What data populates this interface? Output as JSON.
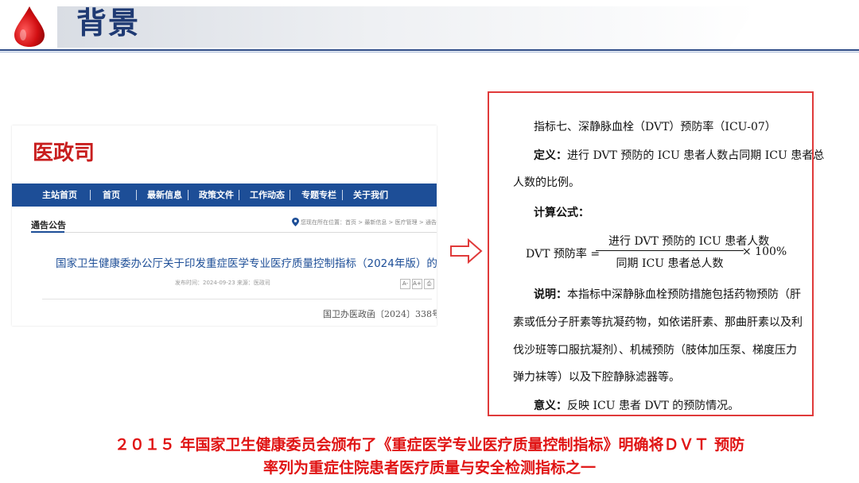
{
  "header": {
    "title": "背景"
  },
  "screenshot": {
    "site_name": "医政司",
    "nav": [
      "主站首页",
      "首页",
      "最新信息",
      "政策文件",
      "工作动态",
      "专题专栏",
      "关于我们"
    ],
    "section_title": "通告公告",
    "breadcrumb": "您现在所在位置：首页 > 最新信息 > 医疗管理 > 通告公",
    "notice_title": "国家卫生健康委办公厅关于印发重症医学专业医疗质量控制指标（2024年版）的通知",
    "publish_meta": "发布时间：2024-09-23   来源：医政司",
    "font_tools": [
      "A-",
      "A+",
      "⎙"
    ],
    "doc_number": "国卫办医政函〔2024〕338号"
  },
  "indicator": {
    "heading": "指标七、深静脉血栓（DVT）预防率（ICU-07）",
    "definition_label": "定义：",
    "definition_line1": "进行 DVT 预防的 ICU 患者人数占同期 ICU 患者总",
    "definition_line2": "人数的比例。",
    "formula_label": "计算公式：",
    "formula_lhs": "DVT 预防率 =",
    "formula_numerator": "进行 DVT 预防的 ICU 患者人数",
    "formula_denominator": "同期 ICU 患者总人数",
    "formula_multiplier": "× 100%",
    "note_label": "说明：",
    "note_line1": "本指标中深静脉血栓预防措施包括药物预防（肝",
    "note_line2": "素或低分子肝素等抗凝药物，如依诺肝素、那曲肝素以及利",
    "note_line3": "伐沙班等口服抗凝剂）、机械预防（肢体加压泵、梯度压力",
    "note_line4": "弹力袜等）以及下腔静脉滤器等。",
    "meaning_label": "意义：",
    "meaning_text": "反映 ICU 患者 DVT 的预防情况。"
  },
  "footer": {
    "line1": "２０１５ 年国家卫生健康委员会颁布了《重症医学专业医疗质量控制指标》明确将ＤＶＴ 预防",
    "line2": "率列为重症住院患者医疗质量与安全检测指标之一"
  },
  "colors": {
    "accent_red": "#e01414",
    "title_blue": "#1f3a73",
    "nav_blue": "#1d4e97",
    "box_border": "#e03a3a"
  }
}
